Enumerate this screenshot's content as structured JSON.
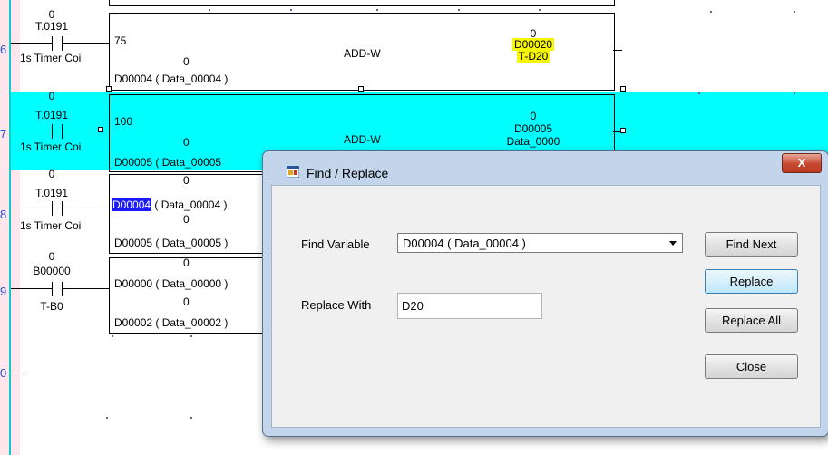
{
  "gutter": {
    "rung_numbers": [
      "6",
      "7",
      "8",
      "9",
      "0"
    ]
  },
  "ladder": {
    "rungs": [
      {
        "contact_value": "0",
        "contact_addr": "T.0191",
        "contact_label": "1s Timer Coi",
        "func_name": "ADD-W",
        "in1": "75",
        "in2_val": "0",
        "in2": "D00004 ( Data_00004 )",
        "out_val": "0",
        "out_addr": "D00020",
        "out_label": "T-D20"
      },
      {
        "contact_value": "0",
        "contact_addr": "T.0191",
        "contact_label": "1s Timer Coi",
        "func_name": "ADD-W",
        "in1": "100",
        "in2_val": "0",
        "in2": "D00005 ( Data_00005",
        "out_val": "0",
        "out_addr": "D00005",
        "out_label": "Data_0000"
      },
      {
        "contact_value": "0",
        "contact_addr": "T.0191",
        "contact_label": "1s Timer Coi",
        "in1_val": "0",
        "in1_sel": "D00004",
        "in1_rest": "( Data_00004 )",
        "in2_val": "0",
        "in2": "D00005 ( Data_00005 )"
      },
      {
        "contact_value": "0",
        "contact_addr": "B00000",
        "contact_label": "T-B0",
        "in1_val": "0",
        "in1": "D00000 ( Data_00000 )",
        "in2_val": "0",
        "in2": "D00002 ( Data_00002 )"
      }
    ]
  },
  "dialog": {
    "title": "Find / Replace",
    "close_glyph": "X",
    "find_label": "Find Variable",
    "find_value": "D00004 ( Data_00004 )",
    "replace_label": "Replace With",
    "replace_value": "D20",
    "buttons": {
      "find_next": "Find Next",
      "replace": "Replace",
      "replace_all": "Replace All",
      "close": "Close"
    }
  },
  "colors": {
    "highlight_rung": "#00ffff",
    "output_highlight": "#f7f700",
    "selection": "#1a1aff"
  }
}
